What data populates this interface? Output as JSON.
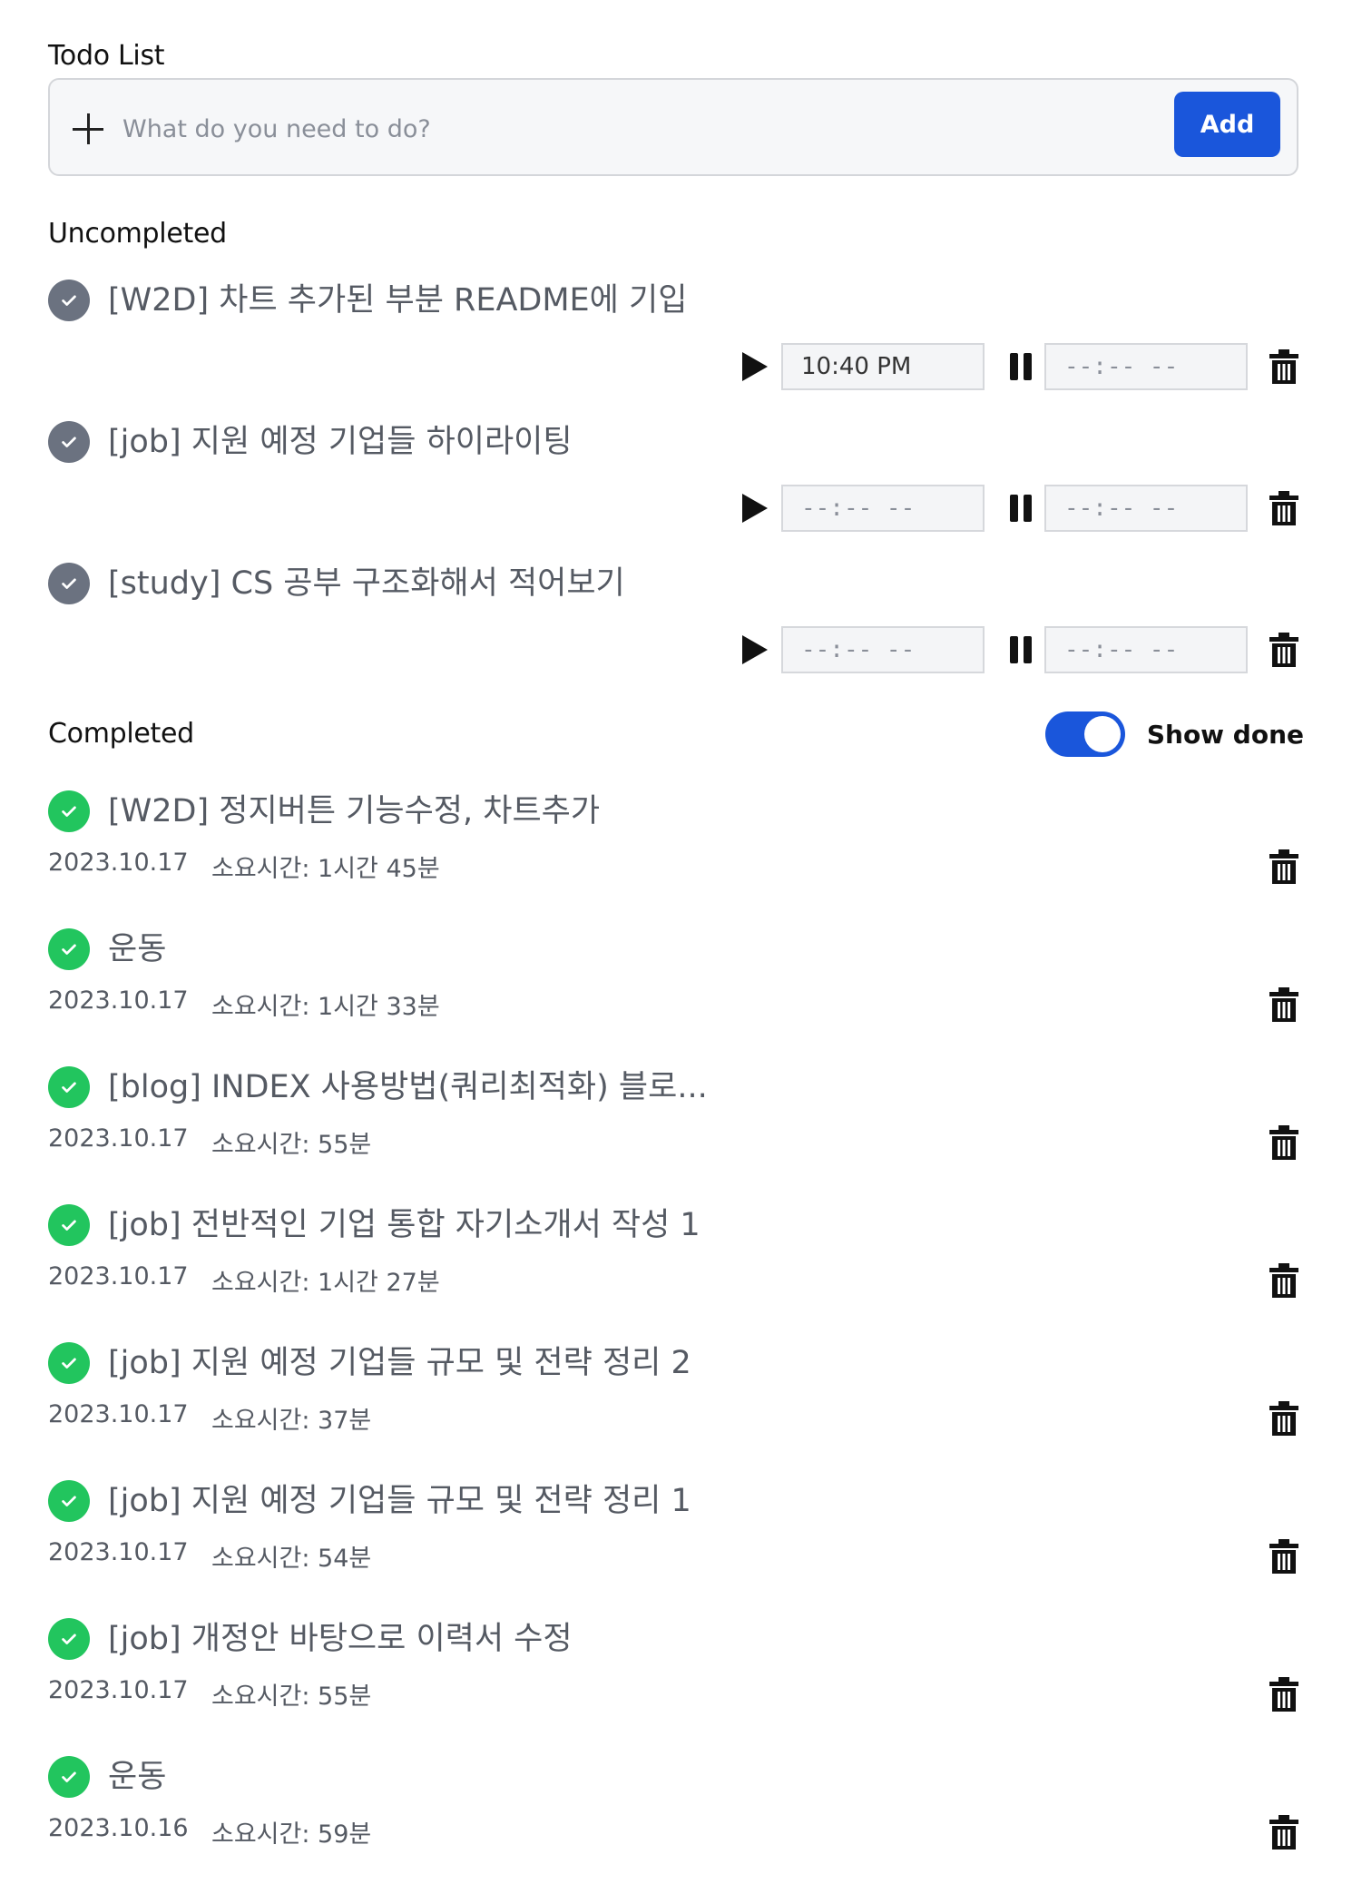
{
  "header": {
    "title": "Todo List"
  },
  "add_bar": {
    "placeholder": "What do you need to do?",
    "button_label": "Add"
  },
  "uncompleted": {
    "title": "Uncompleted",
    "items": [
      {
        "text": "[W2D] 차트 추가된 부분 README에 기입",
        "start_time": "10:40 PM",
        "pause_time": "--:-- --"
      },
      {
        "text": "[job] 지원 예정 기업들 하이라이팅",
        "start_time": "--:-- --",
        "pause_time": "--:-- --"
      },
      {
        "text": "[study] CS 공부 구조화해서 적어보기",
        "start_time": "--:-- --",
        "pause_time": "--:-- --"
      }
    ]
  },
  "completed": {
    "title": "Completed",
    "toggle_label": "Show done",
    "toggle_on": true,
    "items": [
      {
        "text": "[W2D] 정지버튼 기능수정, 차트추가",
        "date": "2023.10.17",
        "duration": "소요시간: 1시간 45분"
      },
      {
        "text": "운동",
        "date": "2023.10.17",
        "duration": "소요시간: 1시간 33분"
      },
      {
        "text": "[blog] INDEX 사용방법(쿼리최적화) 블로...",
        "date": "2023.10.17",
        "duration": "소요시간: 55분"
      },
      {
        "text": "[job] 전반적인 기업 통합 자기소개서 작성 1",
        "date": "2023.10.17",
        "duration": "소요시간: 1시간 27분"
      },
      {
        "text": "[job] 지원 예정 기업들 규모 및 전략 정리 2",
        "date": "2023.10.17",
        "duration": "소요시간: 37분"
      },
      {
        "text": "[job] 지원 예정 기업들 규모 및 전략 정리 1",
        "date": "2023.10.17",
        "duration": "소요시간: 54분"
      },
      {
        "text": "[job] 개정안 바탕으로 이력서 수정",
        "date": "2023.10.17",
        "duration": "소요시간: 55분"
      },
      {
        "text": "운동",
        "date": "2023.10.16",
        "duration": "소요시간: 59분"
      }
    ]
  },
  "colors": {
    "accent": "#1a56db",
    "uncompleted_check": "#6b7280",
    "completed_check": "#22c55e"
  }
}
